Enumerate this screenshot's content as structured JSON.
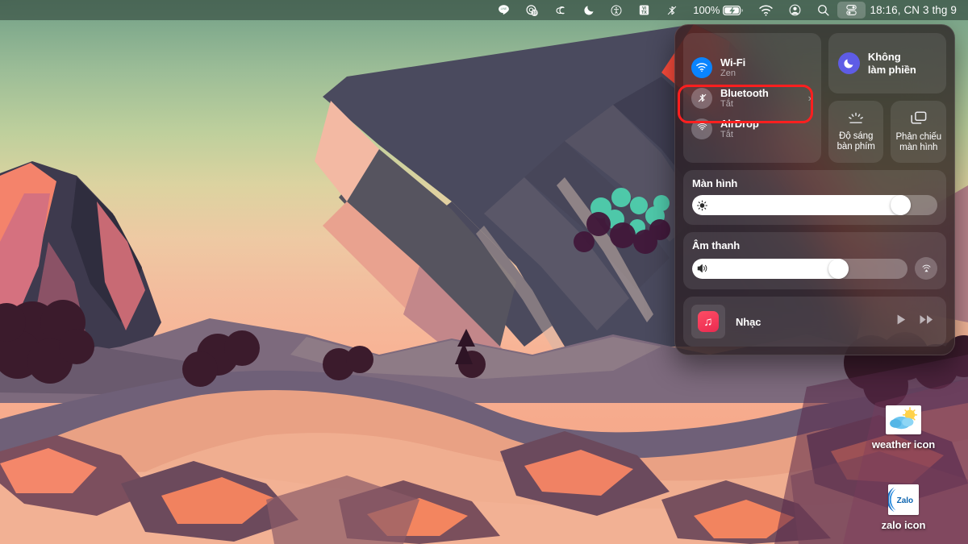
{
  "menubar": {
    "icons": [
      {
        "name": "line-app-icon",
        "label": "LINE"
      },
      {
        "name": "screenshot-badge-icon",
        "label": "10"
      },
      {
        "name": "adobe-creative-cloud-icon",
        "label": "Creative Cloud"
      },
      {
        "name": "do-not-disturb-moon-icon",
        "label": "Do Not Disturb"
      },
      {
        "name": "accessibility-icon",
        "label": "Accessibility"
      },
      {
        "name": "input-source-vitx-icon",
        "label": "VI TX"
      },
      {
        "name": "bluetooth-off-icon",
        "label": "Bluetooth Off"
      }
    ],
    "battery_percent": "100%",
    "battery_state": "charging",
    "wifi_label": "Wi-Fi",
    "account_label": "Account",
    "search_label": "Spotlight Search",
    "control_center_label": "Control Center",
    "clock": "18:16, CN 3 thg 9"
  },
  "control_center": {
    "wifi": {
      "title": "Wi-Fi",
      "subtitle": "Zen",
      "state": "on"
    },
    "bluetooth": {
      "title": "Bluetooth",
      "subtitle": "Tắt",
      "state": "off",
      "chevron": "›",
      "highlighted": true
    },
    "airdrop": {
      "title": "AirDrop",
      "subtitle": "Tắt",
      "state": "off"
    },
    "do_not_disturb": {
      "title": "Không\nlàm phiền",
      "line1": "Không",
      "line2": "làm phiền"
    },
    "keyboard_brightness": {
      "line1": "Độ sáng",
      "line2": "bàn phím"
    },
    "screen_mirroring": {
      "line1": "Phản chiếu",
      "line2": "màn hình"
    },
    "display": {
      "title": "Màn hình",
      "value": 88
    },
    "sound": {
      "title": "Âm thanh",
      "value": 70,
      "airplay_label": "AirPlay"
    },
    "music": {
      "title": "Nhạc",
      "app": "Music",
      "play_label": "Phát",
      "next_label": "Tiếp theo"
    }
  },
  "desktop_icons": [
    {
      "label": "weather icon",
      "name": "desktop-icon-weather"
    },
    {
      "label": "zalo icon",
      "name": "desktop-icon-zalo",
      "badge": "Zalo"
    }
  ],
  "colors": {
    "accent_blue": "#0a84ff",
    "dnd_purple": "#5e5ce6",
    "highlight_red": "#ff1f1f",
    "music_red": "#f43a5a"
  }
}
